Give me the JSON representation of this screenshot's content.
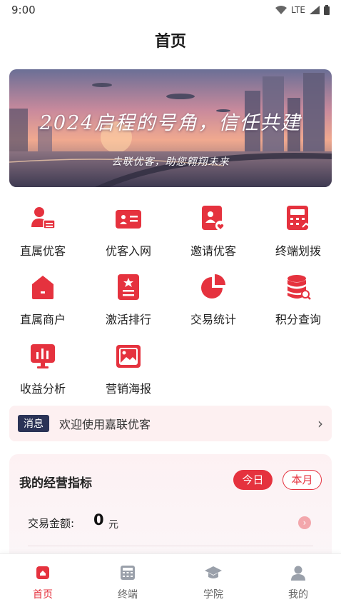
{
  "status_bar": {
    "time": "9:00",
    "network": "LTE"
  },
  "header": {
    "title": "首页"
  },
  "banner": {
    "title": "2024启程的号角，信任共建",
    "subtitle": "去联优客，助您翱翔未来"
  },
  "grid": {
    "items": [
      {
        "label": "直属优客",
        "icon": "user-card-icon"
      },
      {
        "label": "优客入网",
        "icon": "id-card-icon"
      },
      {
        "label": "邀请优客",
        "icon": "invite-icon"
      },
      {
        "label": "终端划拨",
        "icon": "terminal-icon"
      },
      {
        "label": "直属商户",
        "icon": "shop-icon"
      },
      {
        "label": "激活排行",
        "icon": "ranking-icon"
      },
      {
        "label": "交易统计",
        "icon": "pie-chart-icon"
      },
      {
        "label": "积分查询",
        "icon": "database-search-icon"
      },
      {
        "label": "收益分析",
        "icon": "bar-chart-icon"
      },
      {
        "label": "营销海报",
        "icon": "poster-icon"
      }
    ]
  },
  "message": {
    "badge": "消息",
    "text": "欢迎使用嘉联优客",
    "arrow": "›"
  },
  "metrics": {
    "title": "我的经营指标",
    "tabs": [
      "今日",
      "本月"
    ],
    "active_tab": "今日",
    "amount_label": "交易金额:",
    "amount_value": "0",
    "amount_unit": "元",
    "arrow": "›"
  },
  "tabbar": {
    "items": [
      {
        "label": "首页",
        "icon": "home-icon",
        "active": true
      },
      {
        "label": "终端",
        "icon": "calculator-icon",
        "active": false
      },
      {
        "label": "学院",
        "icon": "graduation-cap-icon",
        "active": false
      },
      {
        "label": "我的",
        "icon": "profile-icon",
        "active": false
      }
    ]
  },
  "colors": {
    "accent": "#e5323e",
    "badge_bg": "#2b3356",
    "tab_inactive": "#9aa0aa"
  }
}
